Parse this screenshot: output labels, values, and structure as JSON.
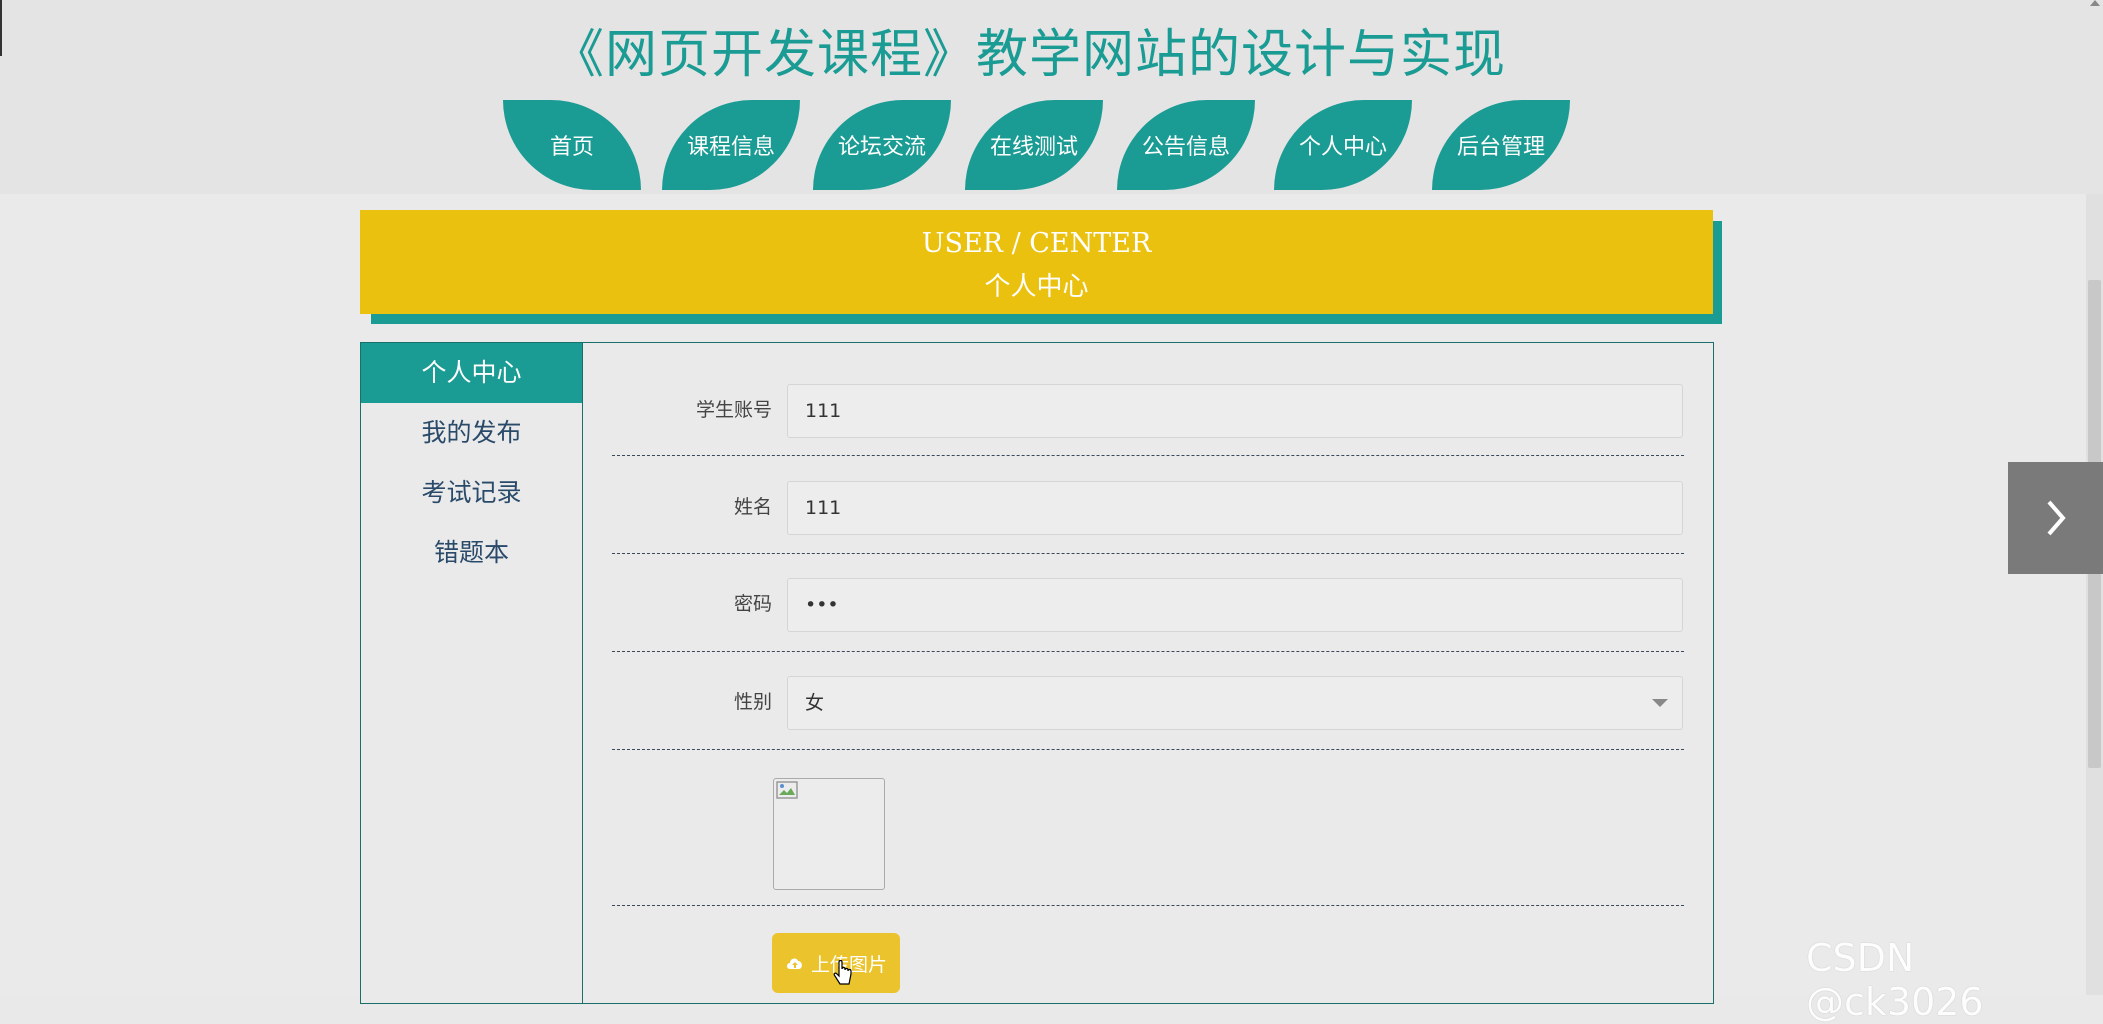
{
  "header": {
    "site_title": "《网页开发课程》教学网站的设计与实现"
  },
  "nav": {
    "items": [
      {
        "label": "首页"
      },
      {
        "label": "课程信息"
      },
      {
        "label": "论坛交流"
      },
      {
        "label": "在线测试"
      },
      {
        "label": "公告信息"
      },
      {
        "label": "个人中心"
      },
      {
        "label": "后台管理"
      }
    ]
  },
  "banner": {
    "en": "USER / CENTER",
    "cn": "个人中心"
  },
  "sidebar": {
    "items": [
      {
        "label": "个人中心",
        "active": true
      },
      {
        "label": "我的发布"
      },
      {
        "label": "考试记录"
      },
      {
        "label": "错题本"
      }
    ]
  },
  "form": {
    "account": {
      "label": "学生账号",
      "value": "111"
    },
    "name": {
      "label": "姓名",
      "value": "111"
    },
    "password": {
      "label": "密码",
      "value": "•••"
    },
    "gender": {
      "label": "性别",
      "value": "女"
    },
    "upload_label": "上传图片"
  },
  "watermark": "CSDN @ck3026",
  "colors": {
    "teal": "#1a9b93",
    "gold": "#ebc10f",
    "upload_button": "#ebc32c"
  },
  "icons": {
    "upload": "cloud-upload-icon",
    "next": "chevron-right-icon",
    "broken_image": "broken-image-icon"
  }
}
